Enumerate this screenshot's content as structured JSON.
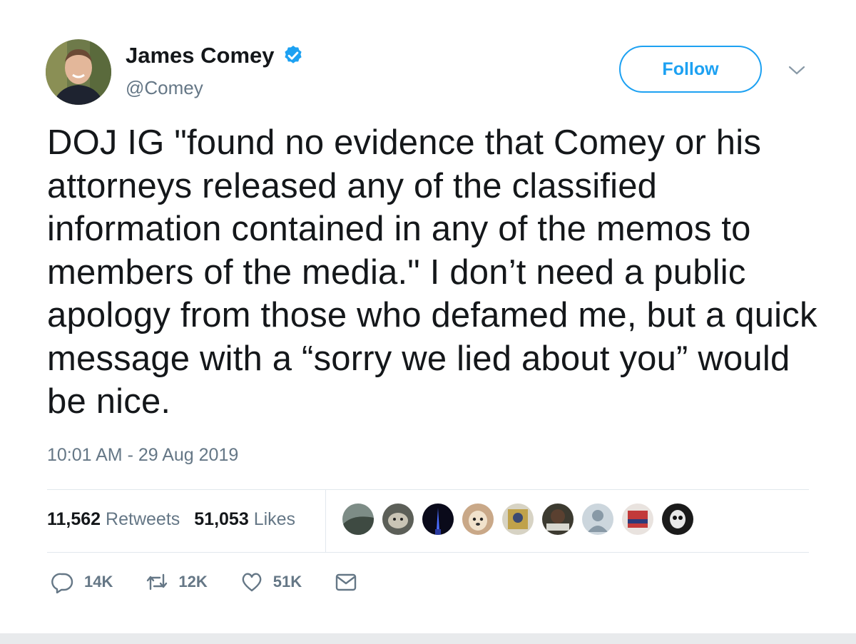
{
  "author": {
    "name": "James Comey",
    "handle": "@Comey",
    "verified_icon": "verified-badge-icon",
    "avatar_icon": "profile-avatar"
  },
  "follow": {
    "label": "Follow"
  },
  "menu": {
    "icon": "chevron-down-icon"
  },
  "tweet": {
    "text": "DOJ IG \"found no evidence that Comey or his attorneys released any of the classified information contained in any of the memos to members of the media.\" I don’t need a public apology from those who defamed me, but a quick message with a “sorry we lied about you” would be nice.",
    "timestamp": "10:01 AM - 29 Aug 2019"
  },
  "stats": {
    "retweets_count": "11,562",
    "retweets_label": "Retweets",
    "likes_count": "51,053",
    "likes_label": "Likes"
  },
  "actions": {
    "replies": "14K",
    "retweets": "12K",
    "likes": "51K"
  },
  "colors": {
    "accent": "#1da1f2",
    "secondary_text": "#657786",
    "primary_text": "#14171a"
  }
}
